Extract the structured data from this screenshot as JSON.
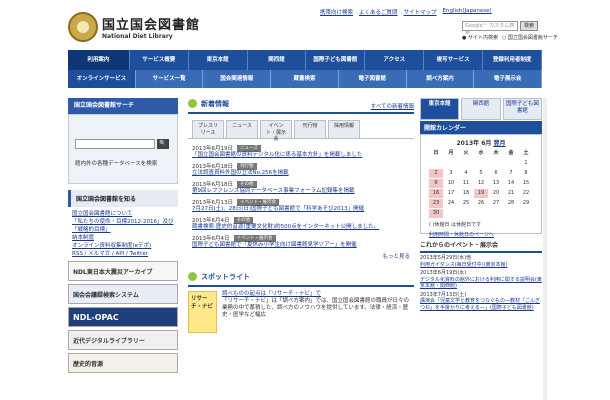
{
  "header": {
    "title": "国立国会図書館",
    "subtitle": "National Diet Library",
    "util": [
      "携帯向け検索",
      "よくあるご質問",
      "サイトマップ",
      "English(Japanese)"
    ],
    "search_placeholder": "Google™ カスタム検索",
    "search_button": "検索",
    "radio_site": "サイト内検索",
    "radio_ndl": "国立国会図書館サーチ"
  },
  "nav1": [
    "利用案内",
    "サービス概要",
    "東京本館",
    "関西館",
    "国際子ども図書館",
    "アクセス",
    "複写サービス",
    "登録利用者制度"
  ],
  "nav2": [
    "オンラインサービス",
    "サービス一覧",
    "国会関連情報",
    "蔵書検索",
    "電子図書館",
    "調べ方案内",
    "電子展示会"
  ],
  "left": {
    "search_title": "国立国会図書館サーチ",
    "search_desc": "館内外の各種データベースを検索",
    "know_title": "国立国会図書館を知る",
    "know_items": [
      "国立国会図書館について",
      "「私たちの使命・目標2012-2016」及び「戦略的目標」",
      "納本制度",
      "オンライン資料収集制度(eデポ)",
      "RSS / メルマガ / API / Twitter"
    ],
    "banners": [
      "NDL東日本大震災アーカイブ",
      "国会会議録検索システム",
      "NDL-OPAC",
      "近代デジタルライブラリー",
      "歴史的音源"
    ]
  },
  "main": {
    "news_title": "新着情報",
    "news_all": "すべての新着情報",
    "tabs": [
      "プレスリリース",
      "ニュース",
      "イベント・展示会",
      "刊行物",
      "採用情報"
    ],
    "news": [
      {
        "date": "2013年6月19日",
        "badge": "ニュース",
        "text": "「国立国会図書館の資料デジタル化に係る基本方針」を掲載しました"
      },
      {
        "date": "2013年6月18日",
        "badge": "刊行物",
        "text": "立法調査資料外国の立法No.256を掲載"
      },
      {
        "date": "2013年6月18日",
        "badge": "その他",
        "text": "第9回レファレンス協同データベース事業フォーラム記録集を掲載"
      },
      {
        "date": "2013年6月13日",
        "badge": "イベント・展示会",
        "text": "7月27日(土)、28日(日)国際子ども図書館で「科学あそび2013」開催"
      },
      {
        "date": "2013年6月4日",
        "badge": "その他",
        "text": "蔵書検索:歴史的音源(重要文化財)約500点をインターネット公開しました。"
      },
      {
        "date": "2013年6月4日",
        "badge": "イベント・展示会",
        "text": "国際子ども図書館で「夏休み小学生向け図書館見学ツアー」を開催"
      }
    ],
    "more": "もっと見る",
    "spot_title": "スポットライト",
    "spot_img": "リサーチ・ナビ",
    "spot_link": "調べものの起点は「リサーチ・ナビ」で",
    "spot_text": "「リサーチ・ナビ」は「調べ方案内」では、国立国会図書館の職員が日々の業務の中で蓄積した、調べ方のノウハウを提供しています。法律・経済・歴史・医学など幅広"
  },
  "right": {
    "tabs": [
      "東京本館",
      "関西館",
      "国際子ども図書館"
    ],
    "cal_title": "開館カレンダー",
    "month": "2013年 6月",
    "next": "翌月",
    "weekdays": [
      "日",
      "月",
      "火",
      "水",
      "木",
      "金",
      "土"
    ],
    "days": [
      "",
      "",
      "",
      "",
      "",
      "",
      "1",
      "2",
      "3",
      "4",
      "5",
      "6",
      "7",
      "8",
      "9",
      "10",
      "11",
      "12",
      "13",
      "14",
      "15",
      "16",
      "17",
      "18",
      "19",
      "20",
      "21",
      "22",
      "23",
      "24",
      "25",
      "26",
      "27",
      "28",
      "29",
      "30",
      "",
      "",
      "",
      "",
      "",
      ""
    ],
    "note": "( )休館日 は休館日です",
    "note2": "利用時間・休館日のページへ",
    "events_title": "これからのイベント・展示会",
    "events": [
      {
        "date": "2013年5月29日(水)他",
        "text": "利用ガイダンス(毎日受付中)(東京本館)"
      },
      {
        "date": "2013年6月19日(水)",
        "text": "デジタル化資料の館外における利用に関する説明会(東京本館・関西館)"
      },
      {
        "date": "2013年7月13日(土)",
        "text": "講演会「児童文学と教育をつなぐもの—教材「ごんぎつね」を手掛かりに考える—」(国際子ども図書館)"
      }
    ]
  }
}
